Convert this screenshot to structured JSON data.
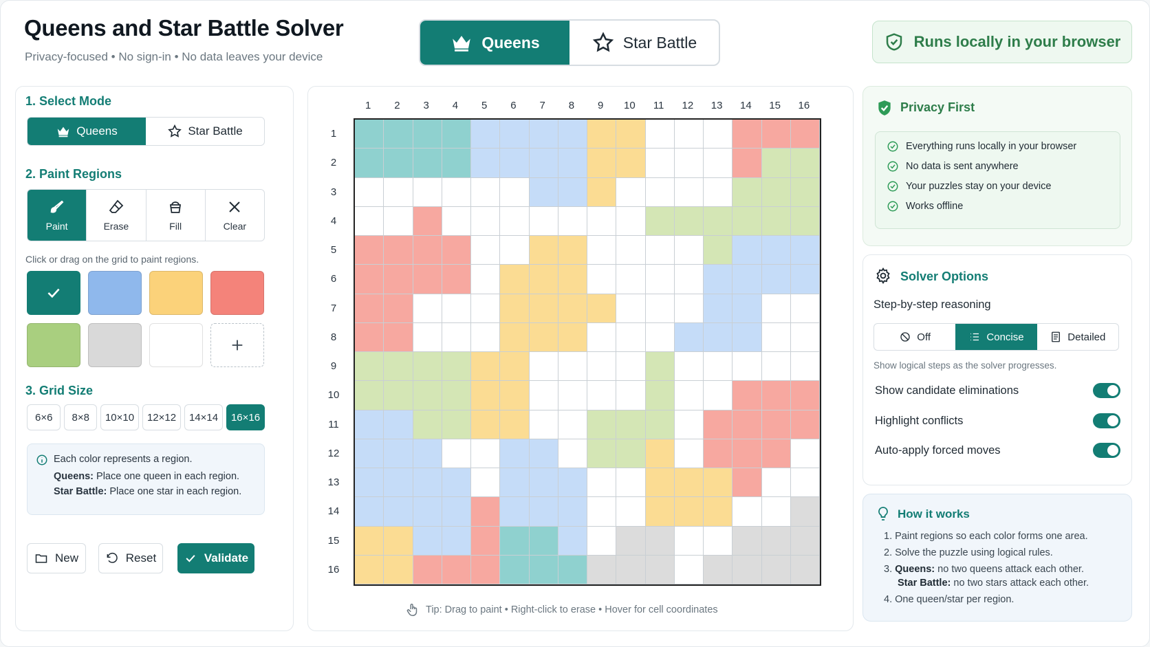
{
  "header": {
    "title": "Queens and Star Battle Solver",
    "subtitle": "Privacy-focused • No sign-in • No data leaves your device",
    "mode_tabs": [
      {
        "label": "Queens",
        "icon": "crown-icon",
        "active": true
      },
      {
        "label": "Star Battle",
        "icon": "star-icon",
        "active": false
      }
    ],
    "local_badge": "Runs locally in your browser"
  },
  "left": {
    "select_mode_title": "1. Select Mode",
    "modes": [
      {
        "label": "Queens",
        "icon": "crown-icon",
        "active": true
      },
      {
        "label": "Star Battle",
        "icon": "star-icon",
        "active": false
      }
    ],
    "paint_title": "2. Paint Regions",
    "tools": [
      {
        "label": "Paint",
        "icon": "brush-icon",
        "active": true
      },
      {
        "label": "Erase",
        "icon": "eraser-icon",
        "active": false
      },
      {
        "label": "Fill",
        "icon": "bucket-icon",
        "active": false
      },
      {
        "label": "Clear",
        "icon": "close-icon",
        "active": false
      }
    ],
    "paint_hint": "Click or drag on the grid to paint regions.",
    "swatches": [
      "#137d74",
      "#8fb8ec",
      "#fbd27a",
      "#f4837a",
      "#a9cf7f",
      "#d9d9d9",
      "#ffffff"
    ],
    "grid_size_title": "3. Grid Size",
    "sizes": [
      "6×6",
      "8×8",
      "10×10",
      "12×12",
      "14×14",
      "16×16"
    ],
    "active_size": "16×16",
    "info": {
      "line1": "Each color represents a region.",
      "queens_label": "Queens:",
      "queens_text": " Place one queen in each region.",
      "star_label": "Star Battle:",
      "star_text": " Place one star in each region."
    },
    "buttons": {
      "new": "New",
      "reset": "Reset",
      "validate": "Validate"
    }
  },
  "grid": {
    "size": 16,
    "colors": {
      "T": "#8fd1cf",
      "B": "#c5dcf8",
      "Y": "#fbdc93",
      "R": "#f7a8a0",
      "G": "#d4e6b5",
      "S": "#dcdcdc",
      "W": "#ffffff"
    },
    "rows": [
      "TTTTBBBBYYWWWRRR",
      "TTTTBBBBYYWWWRGG",
      "WWWWWWBBYWWWWGGG",
      "WWRWWWWWWWGGGGGG",
      "RRRRWWYYWWWWGBBB",
      "RRRRWYYYWWWWBBBB",
      "RRWWWYYYYWWWBBWW",
      "RRWWWYYYWWWBBBWW",
      "GGGGYYWWWWGWWWWW",
      "GGGGYYWWWWGWWRRR",
      "BBGGYYWWGGGWRRRR",
      "BBBWWBBWGGYWRRRW",
      "BBBBWBBBWWYYYRWW",
      "BBBBRBBBWWYYYWWS",
      "YYBBRTTBWSSWWSSS",
      "YYRRRTTTSSSWSSSS"
    ]
  },
  "tip": "Tip: Drag to paint • Right-click to erase • Hover for cell coordinates",
  "privacy": {
    "title": "Privacy First",
    "items": [
      "Everything runs locally in your browser",
      "No data is sent anywhere",
      "Your puzzles stay on your device",
      "Works offline"
    ]
  },
  "solver": {
    "title": "Solver Options",
    "reasoning_label": "Step-by-step reasoning",
    "reasoning_options": [
      {
        "label": "Off",
        "icon": "ban-icon",
        "active": false
      },
      {
        "label": "Concise",
        "icon": "list-icon",
        "active": true
      },
      {
        "label": "Detailed",
        "icon": "document-icon",
        "active": false
      }
    ],
    "reasoning_hint": "Show logical steps as the solver progresses.",
    "toggles": [
      {
        "label": "Show candidate eliminations",
        "on": true
      },
      {
        "label": "Highlight conflicts",
        "on": true
      },
      {
        "label": "Auto-apply forced moves",
        "on": true
      }
    ]
  },
  "how": {
    "title": "How it works",
    "steps": [
      {
        "num": "1.",
        "text": "Paint regions so each color forms one area."
      },
      {
        "num": "2.",
        "text": "Solve the puzzle using logical rules."
      },
      {
        "num": "3.",
        "bold": "Queens:",
        "text": " no two queens attack each other."
      },
      {
        "num": "",
        "bold": "Star Battle:",
        "text": " no two stars attack each other."
      },
      {
        "num": "4.",
        "text": "One queen/star per region."
      }
    ]
  }
}
